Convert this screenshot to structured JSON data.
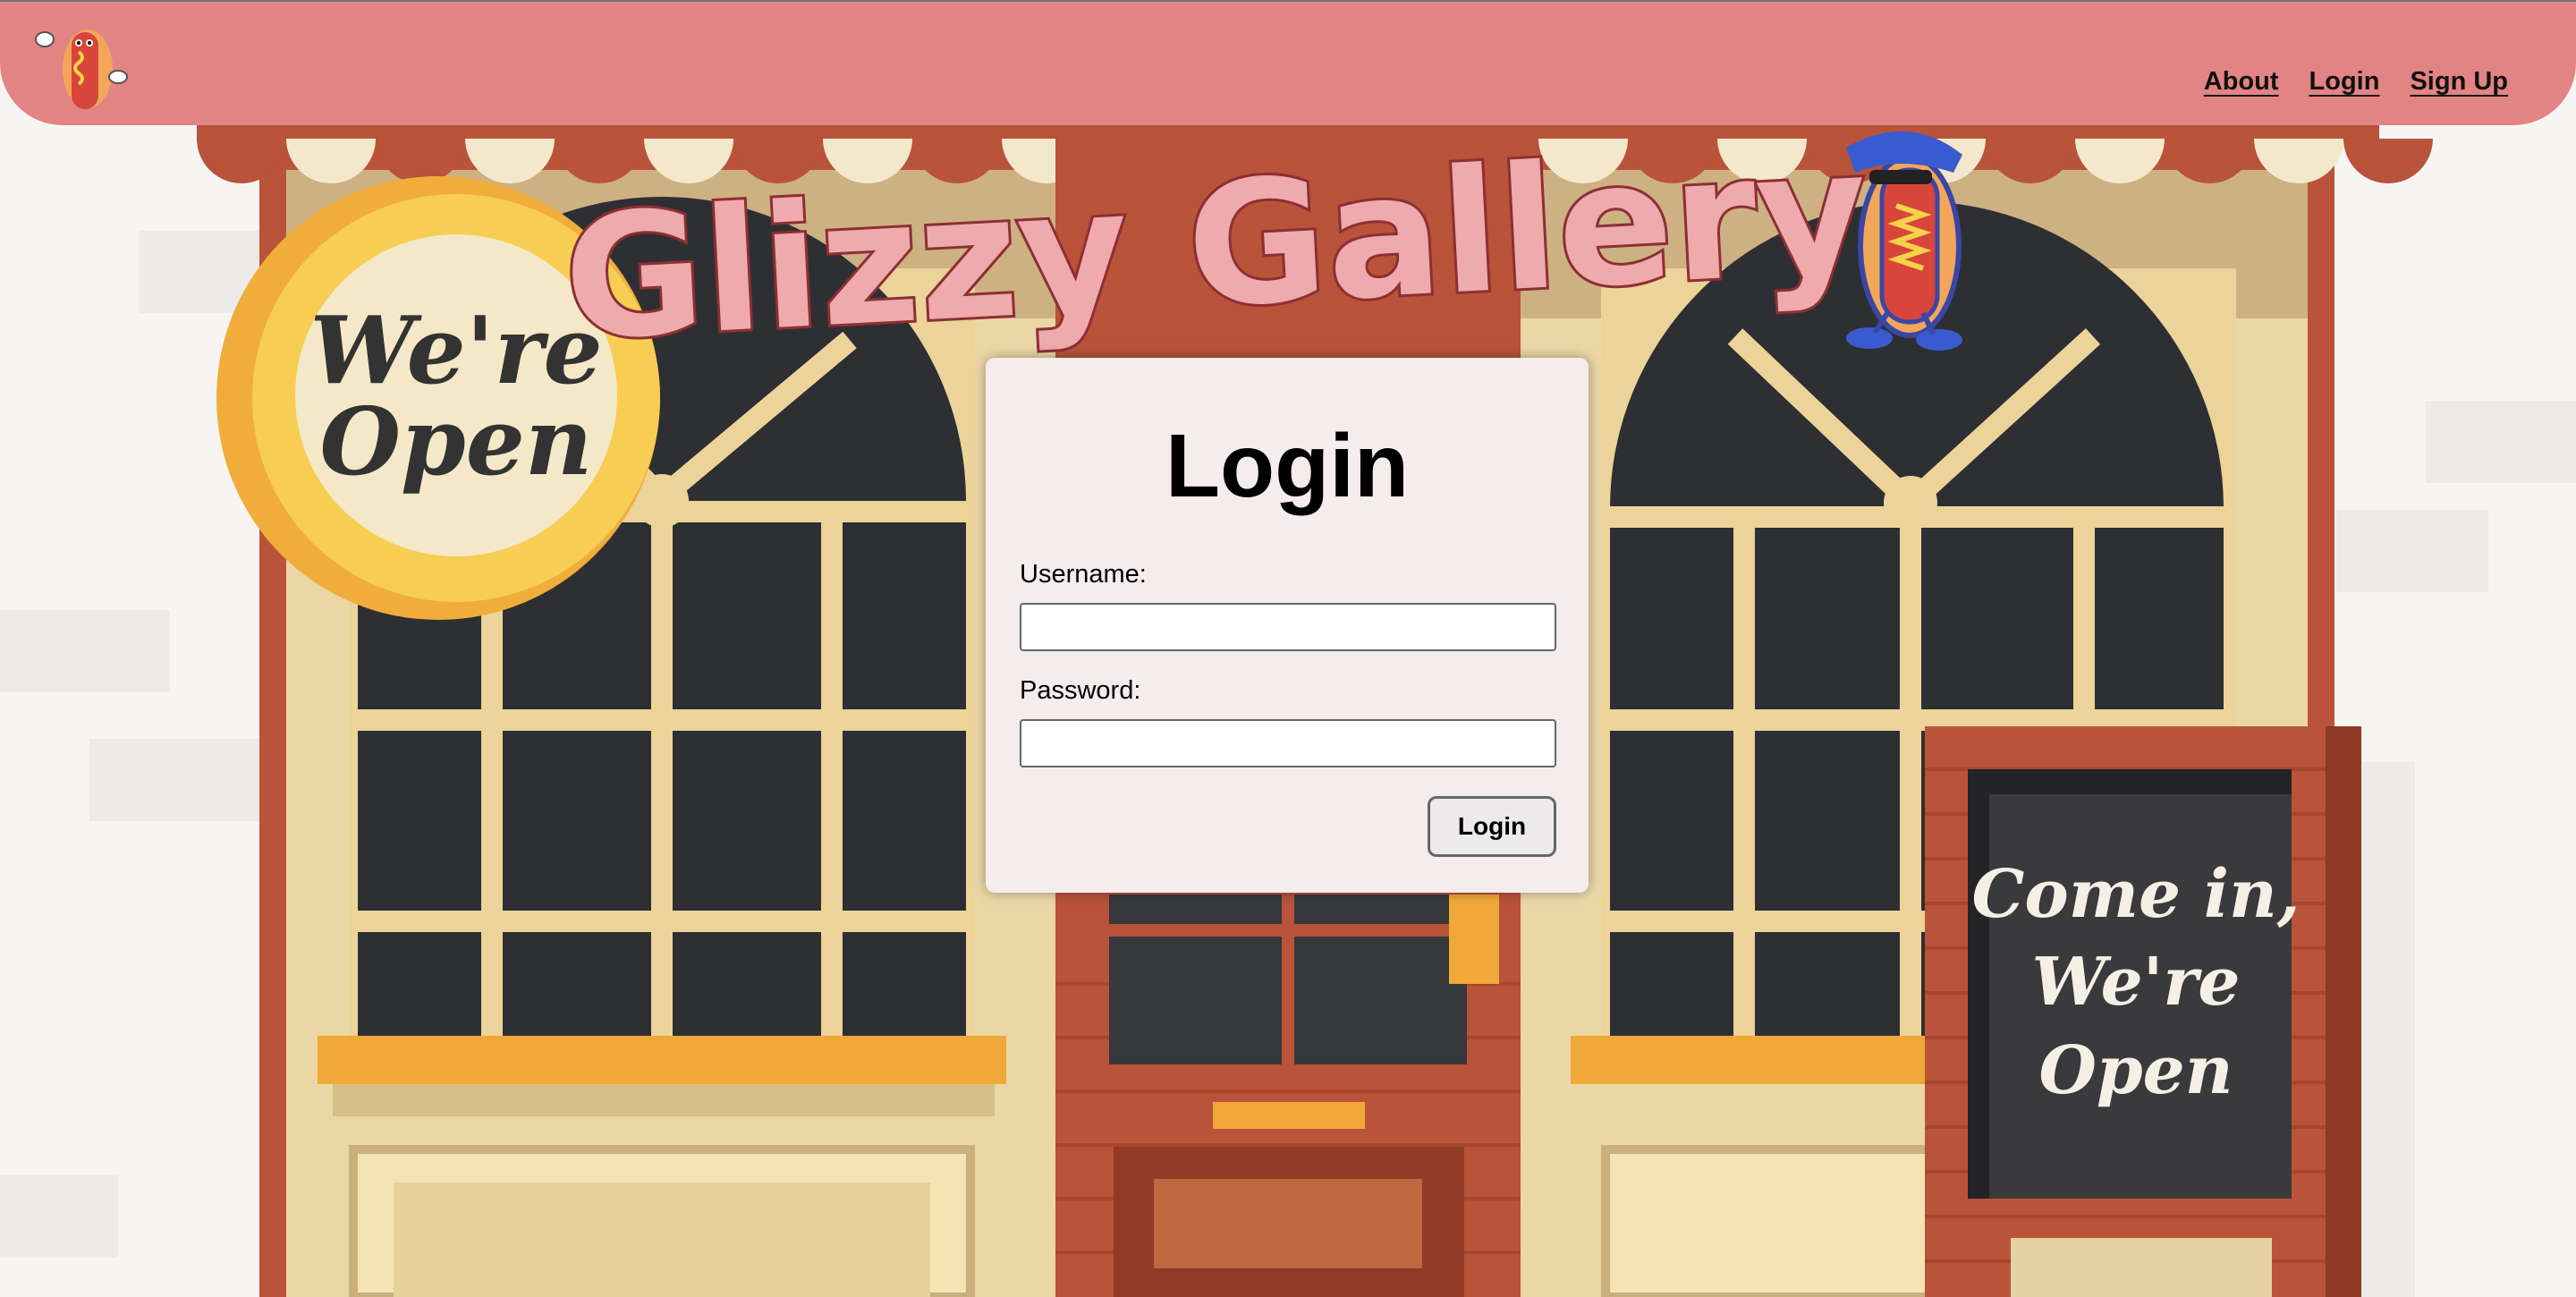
{
  "nav": {
    "logo_icon": "hotdog-mascot-icon",
    "links": [
      {
        "label": "About"
      },
      {
        "label": "Login"
      },
      {
        "label": "Sign Up"
      }
    ],
    "background": "#e28483"
  },
  "banner": {
    "title": "Glizzy Gallery",
    "mascot_icon": "hotdog-with-sunglasses-icon"
  },
  "storefront": {
    "open_sign_text_line1": "We're",
    "open_sign_text_line2": "Open",
    "chalkboard_line1": "Come in,",
    "chalkboard_line2": "We're",
    "chalkboard_line3": "Open"
  },
  "login_form": {
    "title": "Login",
    "username_label": "Username:",
    "username_value": "",
    "password_label": "Password:",
    "password_value": "",
    "submit_label": "Login"
  }
}
